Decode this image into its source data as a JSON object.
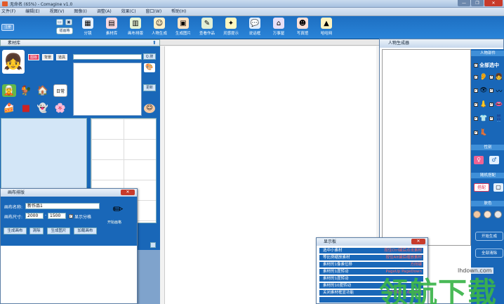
{
  "window": {
    "title": "无命名 (65%) - Comagine v1.0",
    "controls": [
      "—",
      "❐",
      "✕"
    ]
  },
  "menu": [
    "文件(F)",
    "编辑(E)",
    "视图(V)",
    "图像(I)",
    "调整(A)",
    "效果(C)",
    "窗口(W)",
    "帮助(H)"
  ],
  "toolbar": {
    "register_label": "注册",
    "small_btn2_label": "插画格",
    "tools": [
      {
        "label": "分镜",
        "icon": "storyboard-icon",
        "glyph": "▦",
        "color": "#e8f2ff"
      },
      {
        "label": "素材库",
        "icon": "material-library-icon",
        "glyph": "▤",
        "color": "#f7d9e0"
      },
      {
        "label": "画布排版",
        "icon": "canvas-layout-icon",
        "glyph": "▥",
        "color": "#e6f4d7"
      },
      {
        "label": "人物生成",
        "icon": "character-generator-icon",
        "glyph": "☺",
        "color": "#fff0c8"
      },
      {
        "label": "生成图片",
        "icon": "generate-image-icon",
        "glyph": "▣",
        "color": "#ffe2c2"
      },
      {
        "label": "查看作品",
        "icon": "view-works-icon",
        "glyph": "✎",
        "color": "#e3f0d6"
      },
      {
        "label": "灵感提示",
        "icon": "inspiration-icon",
        "glyph": "✦",
        "color": "#fff7c0"
      },
      {
        "label": "说话框",
        "icon": "speech-bubble-icon",
        "glyph": "💬",
        "color": "#e2eefc"
      },
      {
        "label": "万事屋",
        "icon": "shop-icon",
        "glyph": "⌂",
        "color": "#e8e0f7"
      },
      {
        "label": "写真馆",
        "icon": "photo-studio-icon",
        "glyph": "☻",
        "color": "#fde0d6"
      },
      {
        "label": "哈哈网",
        "icon": "haha-net-icon",
        "glyph": "▲",
        "color": "#fff3bf"
      }
    ]
  },
  "material_panel": {
    "title": "素材库",
    "categories": [
      "图版",
      "背景",
      "道具"
    ],
    "search_label": "Q.搜",
    "side_button_label": "更新"
  },
  "canvas_dialog": {
    "title": "画布排版",
    "name_label": "画布名称:",
    "name_value": "新作品1",
    "size_label": "画布尺寸:",
    "width": "2000",
    "height": "1500",
    "show_grid_label": "显示分格",
    "show_grid_checked": "✓",
    "draw_label": "开始画格",
    "buttons": [
      "生成画布",
      "清除",
      "生成图片",
      "加载画布"
    ]
  },
  "char_generator": {
    "title": "人物生成器",
    "parts_header": "人物部件",
    "select_all": "全部选中",
    "gender_header": "性别",
    "random_header": "随机搭配",
    "random_btn": "搭配",
    "skin_header": "肤色",
    "start_btn": "开始生成",
    "clear_btn": "全部清除",
    "skin_colors": [
      "#f4c8a0",
      "#fbe3cc",
      "#e7e7e7"
    ]
  },
  "display_board": {
    "title": "显示板",
    "rows": [
      {
        "left": "选中小素材",
        "right": "按住Ctrl键后点击素材"
      },
      {
        "left": "等比例缩放素材",
        "right": "按住Alt键后缩放素材"
      },
      {
        "left": "素材的1像素位移",
        "right": "方向键"
      },
      {
        "left": "素材的1度转动",
        "right": "PageUp PageDown"
      },
      {
        "left": "素材的1度转动",
        "right": ""
      },
      {
        "left": "素材的10度转动",
        "right": ""
      },
      {
        "left": "关闭素材框显功能",
        "right": "在白画布上点击鼠标"
      },
      {
        "left": "",
        "right": ""
      }
    ]
  },
  "watermark": {
    "text": "领航下载",
    "url": "lhdown.com"
  }
}
